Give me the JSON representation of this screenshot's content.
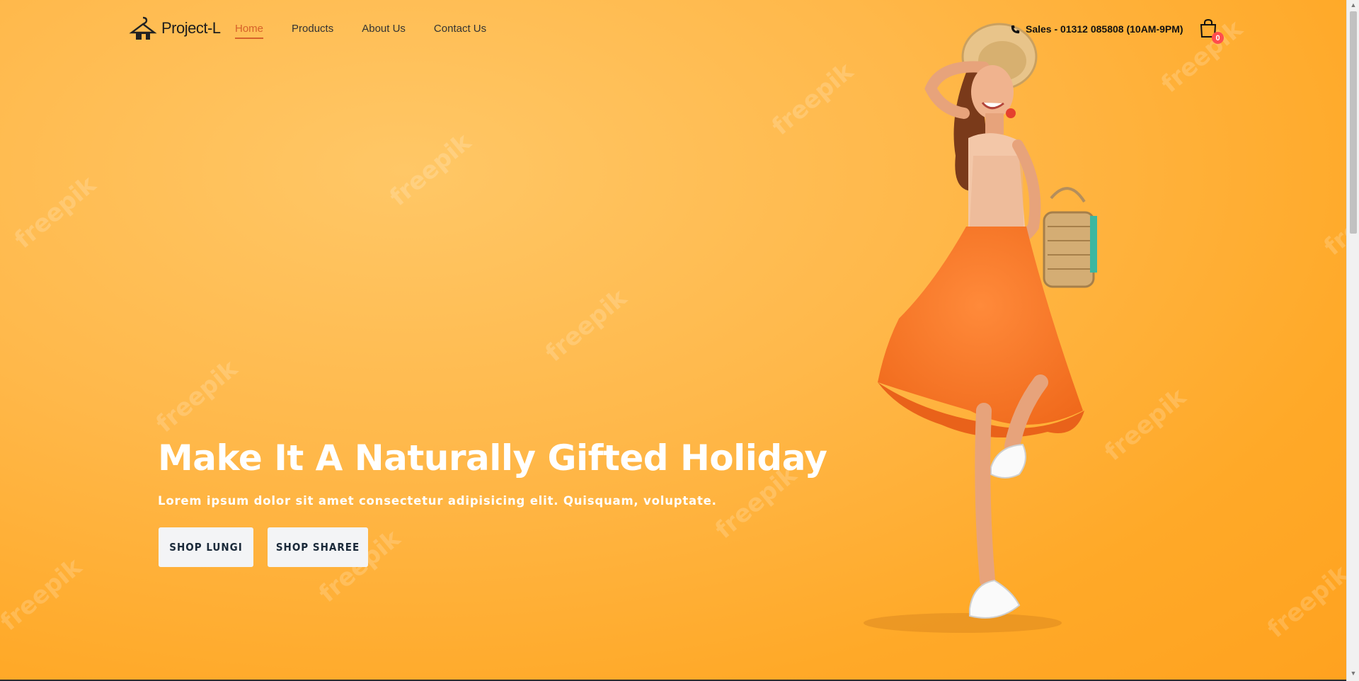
{
  "header": {
    "logo_text": "Project-L",
    "nav": [
      {
        "label": "Home",
        "active": true
      },
      {
        "label": "Products",
        "active": false
      },
      {
        "label": "About Us",
        "active": false
      },
      {
        "label": "Contact Us",
        "active": false
      }
    ],
    "phone_text": "Sales - 01312 085808 (10AM-9PM)",
    "phone_icon": "phone-icon",
    "cart_icon": "shopping-bag-icon",
    "cart_count": "0"
  },
  "hero": {
    "headline": "Make It A Naturally Gifted Holiday",
    "subtext": "Lorem ipsum dolor sit amet consectetur adipisicing elit. Quisquam, voluptate.",
    "buttons": [
      {
        "label": "SHOP LUNGI"
      },
      {
        "label": "SHOP SHAREE"
      }
    ],
    "watermark_text": "freepik"
  },
  "colors": {
    "background": "#ffb23a",
    "accent": "#d6612a",
    "badge": "#ff4d4d",
    "button_bg": "#f3f4f6",
    "button_text": "#1b2a3a"
  }
}
